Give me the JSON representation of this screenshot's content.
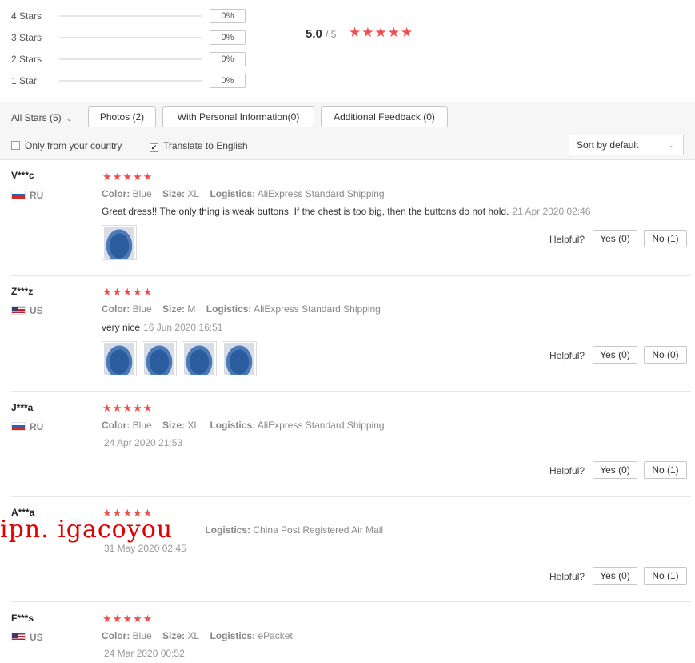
{
  "summary": {
    "distribution": [
      {
        "label": "4 Stars",
        "percent": "0%",
        "fill": 0
      },
      {
        "label": "3 Stars",
        "percent": "0%",
        "fill": 0
      },
      {
        "label": "2 Stars",
        "percent": "0%",
        "fill": 0
      },
      {
        "label": "1 Star",
        "percent": "0%",
        "fill": 0
      }
    ],
    "score": "5.0",
    "score_out_of": "/ 5",
    "stars": 5
  },
  "filters": {
    "all_stars": "All Stars (5)",
    "photos": "Photos (2)",
    "personal_info": "With Personal Information(0)",
    "additional_feedback": "Additional Feedback (0)",
    "only_country": "Only from your country",
    "only_country_checked": false,
    "translate": "Translate to English",
    "translate_checked": true,
    "sort": "Sort by default"
  },
  "labels": {
    "color": "Color:",
    "size": "Size:",
    "logistics": "Logistics:",
    "helpful": "Helpful?"
  },
  "reviews": [
    {
      "name": "V***c",
      "country": "RU",
      "stars": 5,
      "color": "Blue",
      "size": "XL",
      "logistics": "AliExpress Standard Shipping",
      "text": "Great dress!! The only thing is weak buttons. If the chest is too big, then the buttons do not hold.",
      "date": "21 Apr 2020 02:46",
      "photos": 1,
      "yes": "Yes (0)",
      "no": "No (1)"
    },
    {
      "name": "Z***z",
      "country": "US",
      "stars": 5,
      "color": "Blue",
      "size": "M",
      "logistics": "AliExpress Standard Shipping",
      "text": "very nice",
      "date": "16 Jun 2020 16:51",
      "photos": 4,
      "yes": "Yes (0)",
      "no": "No (0)"
    },
    {
      "name": "J***a",
      "country": "RU",
      "stars": 5,
      "color": "Blue",
      "size": "XL",
      "logistics": "AliExpress Standard Shipping",
      "text": "",
      "date": "24 Apr 2020 21:53",
      "photos": 0,
      "yes": "Yes (0)",
      "no": "No (1)"
    },
    {
      "name": "A***a",
      "country": "",
      "stars": 5,
      "color": "Blue",
      "size": "",
      "logistics": "China Post Registered Air Mail",
      "text": "",
      "date": "31 May 2020 02:45",
      "photos": 0,
      "yes": "Yes (0)",
      "no": "No (1)"
    },
    {
      "name": "F***s",
      "country": "US",
      "stars": 5,
      "color": "Blue",
      "size": "XL",
      "logistics": "ePacket",
      "text": "",
      "date": "24 Mar 2020 00:52",
      "photos": 0,
      "yes": "",
      "no": ""
    }
  ],
  "watermark": "ipn. igacoyou",
  "colors": {
    "star": "#f04d4f",
    "divider": "#e6e6e6",
    "watermark": "#e00000"
  },
  "icons": {
    "star": "star-icon",
    "checkbox": "checkbox-icon",
    "chevron": "chevron-down-icon"
  }
}
